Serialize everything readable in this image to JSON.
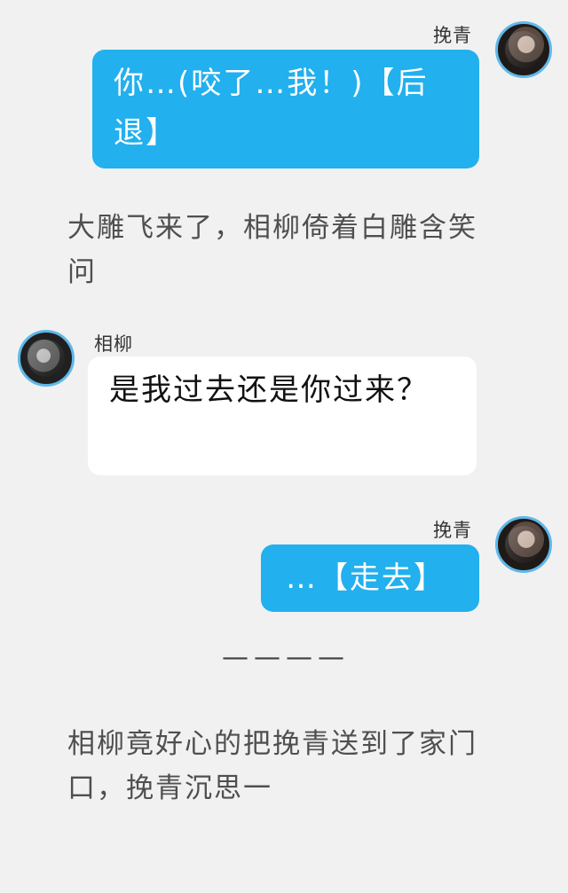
{
  "messages": [
    {
      "sender": "挽青",
      "text": "你…(咬了…我！)【后退】"
    },
    {
      "sender": "相柳",
      "text": "是我过去还是你过来？"
    },
    {
      "sender": "挽青",
      "text": "…【走去】"
    }
  ],
  "narration": [
    "大雕飞来了，相柳倚着白雕含笑问",
    "相柳竟好心的把挽青送到了家门口，挽青沉思一"
  ],
  "divider": "————"
}
